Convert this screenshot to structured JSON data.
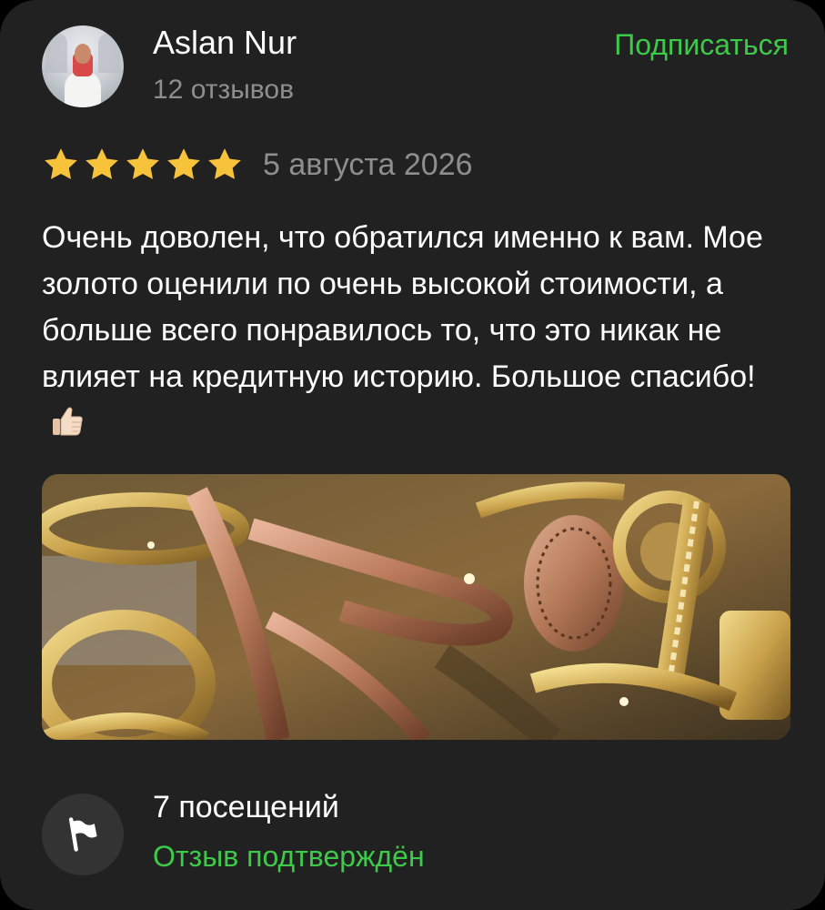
{
  "author": {
    "name": "Aslan Nur",
    "reviews_count": "12 отзывов",
    "subscribe_label": "Подписаться"
  },
  "rating": {
    "stars": 5,
    "max_stars": 5,
    "date": "5 августа 2026"
  },
  "review": {
    "text": "Очень доволен, что обратился именно к вам. Мое золото оценили по очень высокой стоимости, а больше всего понравилось то, что это никак не влияет на кредитную историю. Большое спасибо!",
    "emoji_icon": "thumbs-up-icon"
  },
  "photo": {
    "subject": "gold-jewelry-photo"
  },
  "footer": {
    "visits": "7 посещений",
    "verified_label": "Отзыв подтверждён",
    "icon": "flag-icon"
  },
  "colors": {
    "card_background": "#212121",
    "accent_green": "#3dc94a",
    "star_gold": "#f7c33b",
    "muted_text": "#8e8e8e"
  }
}
